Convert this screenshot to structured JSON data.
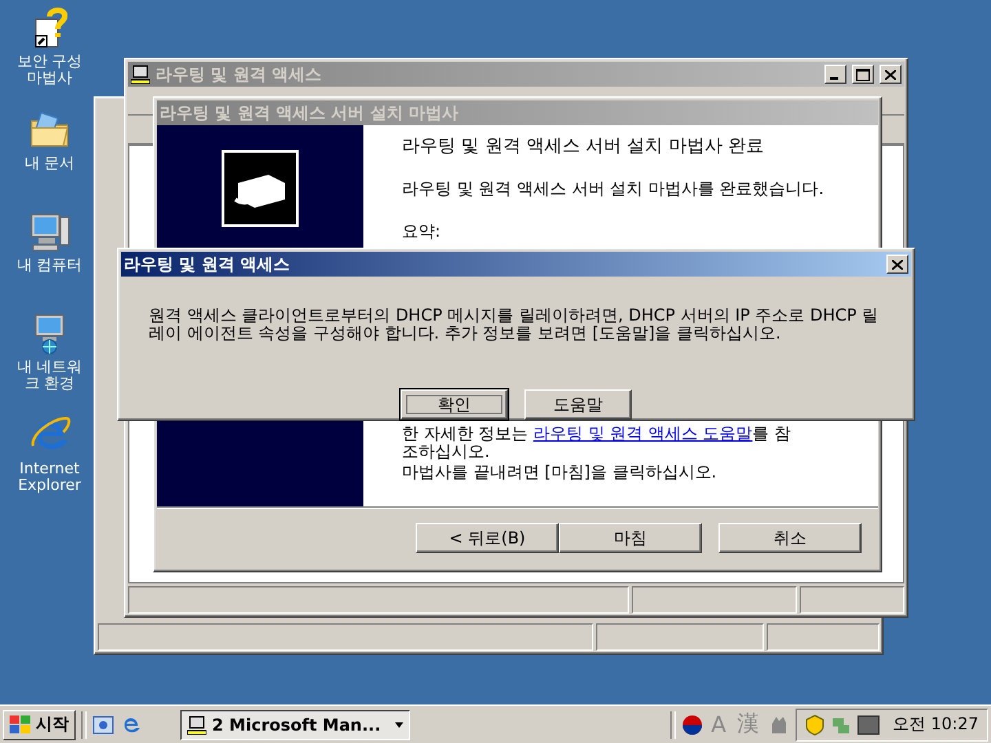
{
  "desktop_icons": [
    {
      "label": "보안 구성 마법사",
      "kind": "wizard"
    },
    {
      "label": "내 문서",
      "kind": "documents"
    },
    {
      "label": "내 컴퓨터",
      "kind": "computer"
    },
    {
      "label": "내 네트워크 환경",
      "kind": "network"
    },
    {
      "label": "Internet Explorer",
      "kind": "ie"
    }
  ],
  "main_window": {
    "title": "라우팅 및 원격 액세스",
    "active": false
  },
  "wizard": {
    "title": "라우팅 및 원격 액세스 서버 설치 마법사",
    "active": false,
    "heading": "라우팅 및 원격 액세스 서버 설치 마법사 완료",
    "intro": "라우팅 및 원격 액세스 서버 설치 마법사를 완료했습니다.",
    "summary_label": "요약:",
    "help_before": "한 자세한 정보는 ",
    "help_link": "라우팅 및 원격 액세스 도움말",
    "help_after": "를 참조하십시오.",
    "finish_hint": "마법사를 끝내려면 [마침]을 클릭하십시오.",
    "buttons": [
      {
        "label": "< 뒤로(B)",
        "default": false
      },
      {
        "label": "마침",
        "default": false
      },
      {
        "label": "취소",
        "default": false
      }
    ]
  },
  "message_box": {
    "title": "라우팅 및 원격 액세스",
    "active": true,
    "message": "원격 액세스 클라이언트로부터의 DHCP 메시지를 릴레이하려면, DHCP 서버의 IP 주소로 DHCP 릴레이 에이전트 속성을 구성해야 합니다. 추가 정보를 보려면 [도움말]을 클릭하십시오.",
    "buttons": [
      {
        "label": "확인",
        "default": true
      },
      {
        "label": "도움말",
        "default": false
      }
    ]
  },
  "taskbar": {
    "start": "시작",
    "task": "2 Microsoft Man...",
    "tray_glyphs": [
      "A",
      "漢"
    ],
    "clock": "오전 10:27"
  }
}
